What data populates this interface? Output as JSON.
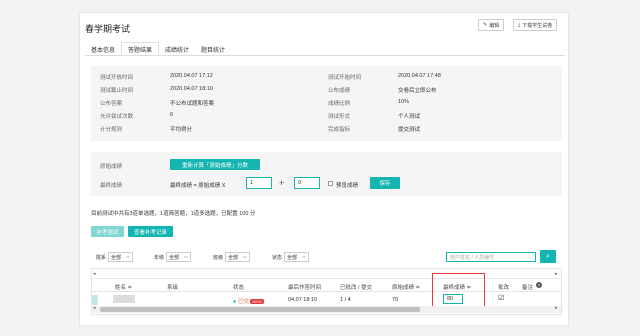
{
  "header": {
    "title": "春学期考试",
    "edit_label": "编辑",
    "download_label": "下载学生试卷"
  },
  "tabs": [
    {
      "label": "基本信息"
    },
    {
      "label": "答题结果"
    },
    {
      "label": "成绩统计"
    },
    {
      "label": "题目统计"
    }
  ],
  "info": {
    "left": [
      {
        "label": "测试开放时间",
        "value": "2020.04.07 17:12"
      },
      {
        "label": "测试截止时间",
        "value": "2020.04.07 18:10"
      },
      {
        "label": "公布答案",
        "value": "不公布试题和答案"
      },
      {
        "label": "允许尝试次数",
        "value": "6"
      },
      {
        "label": "计分规则",
        "value": "平均得分"
      }
    ],
    "right": [
      {
        "label": "测试开始时间",
        "value": "2020.04.07 17:48"
      },
      {
        "label": "公布成绩",
        "value": "交卷后立即公布"
      },
      {
        "label": "成绩比例",
        "value": "10%"
      },
      {
        "label": "测试形式",
        "value": "个人测试"
      },
      {
        "label": "完成指标",
        "value": "提交测试"
      }
    ]
  },
  "score": {
    "raw_label": "原始成绩",
    "recalc_button": "重新计算「原始成绩」分数",
    "final_label": "最终成绩",
    "formula_text": "最终成绩 = 原始成绩 X",
    "multiplier": "1",
    "plus": "+",
    "offset": "0",
    "preview_label": "预览成绩",
    "save_button": "保存"
  },
  "summary": "目前测试中共有3道单选题，1道简答题，1道多选题，已配置 100 分",
  "actions": {
    "makeup_test": "补考测试",
    "view_makeup": "查看补考记录"
  },
  "filters": [
    {
      "label": "院系",
      "value": "全部"
    },
    {
      "label": "年级",
      "value": "全部"
    },
    {
      "label": "班级",
      "value": "全部"
    },
    {
      "label": "状态",
      "value": "全部"
    }
  ],
  "search": {
    "placeholder": "用户姓名 / 人员编号"
  },
  "table": {
    "headers": {
      "name": "姓名 ≑",
      "dept": "系级",
      "status": "状态",
      "last_submit": "最后作答时间",
      "graded": "已批改 / 提交",
      "raw_score": "原始成绩 ≑",
      "final_score": "最终成绩 ≑",
      "grade": "批改",
      "note": "备注"
    },
    "rows": [
      {
        "status": "已交",
        "badge": "NEW",
        "last_submit": "04.07 18:10",
        "graded": "1 / 4",
        "raw_score": "70",
        "final_score": "80"
      }
    ]
  },
  "colors": {
    "accent": "#14b5b0",
    "highlight": "#e53935"
  }
}
